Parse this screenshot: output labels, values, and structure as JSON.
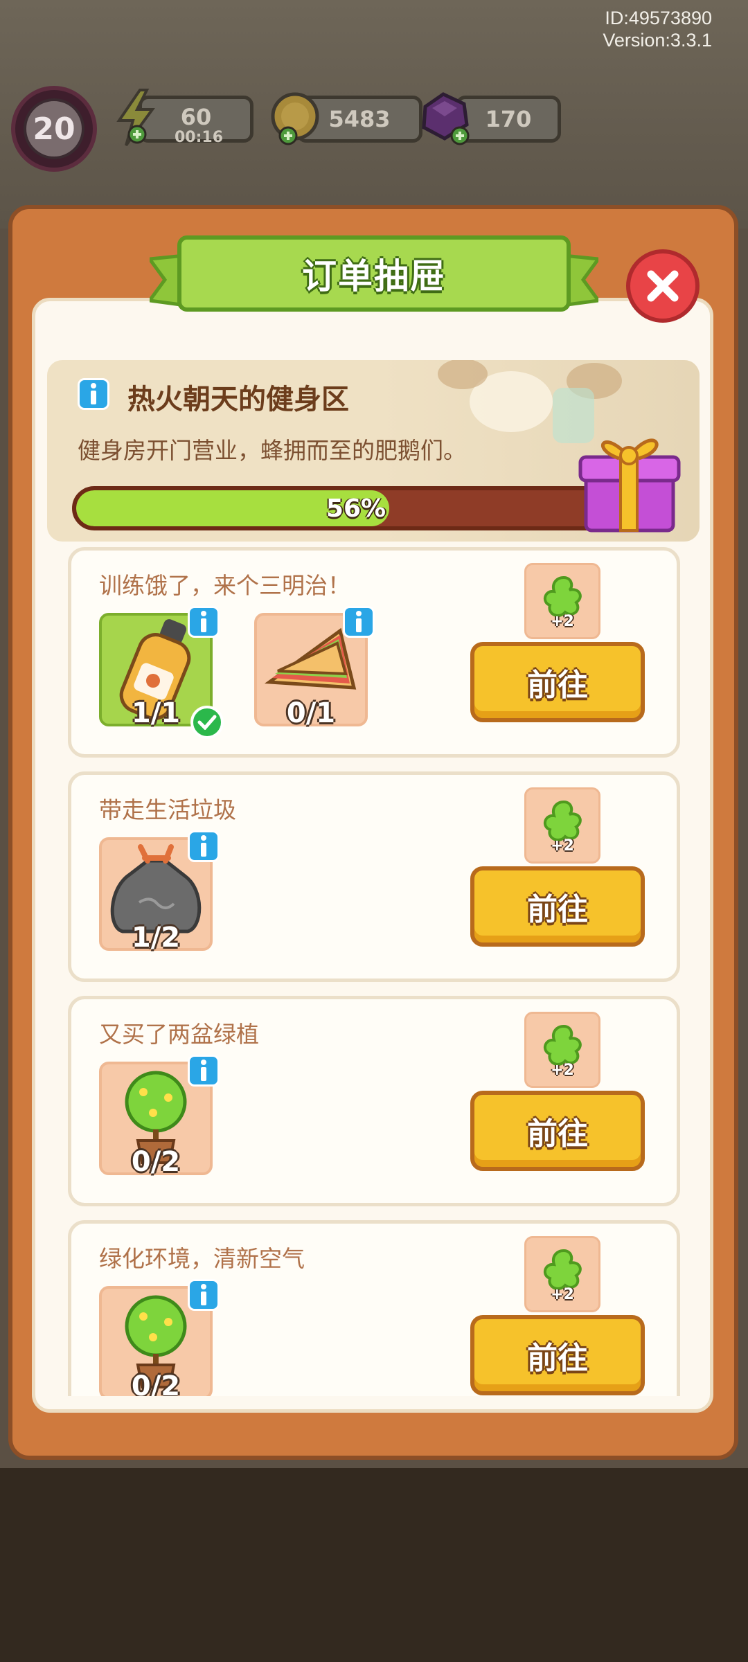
{
  "meta": {
    "id_label": "ID:49573890",
    "version_label": "Version:3.3.1"
  },
  "hud": {
    "level": "20",
    "energy": "60",
    "energy_timer": "00:16",
    "coins": "5483",
    "gems": "170"
  },
  "modal": {
    "title": "订单抽屉",
    "close_icon": "close-icon"
  },
  "stage": {
    "title": "热火朝天的健身区",
    "description": "健身房开门营业，蜂拥而至的肥鹅们。",
    "progress_label": "56%",
    "progress_value": 0.56
  },
  "orders": [
    {
      "title": "训练饿了，来个三明治！",
      "items": [
        {
          "icon": "juice-bottle-icon",
          "count": "1/1",
          "done": true
        },
        {
          "icon": "sandwich-icon",
          "count": "0/1",
          "done": false
        }
      ],
      "reward": "+2",
      "button": "前往"
    },
    {
      "title": "带走生活垃圾",
      "items": [
        {
          "icon": "garbage-bag-icon",
          "count": "1/2",
          "done": false
        }
      ],
      "reward": "+2",
      "button": "前往"
    },
    {
      "title": "又买了两盆绿植",
      "items": [
        {
          "icon": "potted-plant-icon",
          "count": "0/2",
          "done": false
        }
      ],
      "reward": "+2",
      "button": "前往"
    },
    {
      "title": "绿化环境，清新空气",
      "items": [
        {
          "icon": "potted-plant-icon",
          "count": "0/2",
          "done": false
        }
      ],
      "reward": "+2",
      "button": "前往"
    }
  ],
  "colors": {
    "modal_frame": "#cf7a3e",
    "title_green": "#a7d94f",
    "button_yellow": "#f6c22b",
    "progress_fill": "#a7df3f"
  }
}
